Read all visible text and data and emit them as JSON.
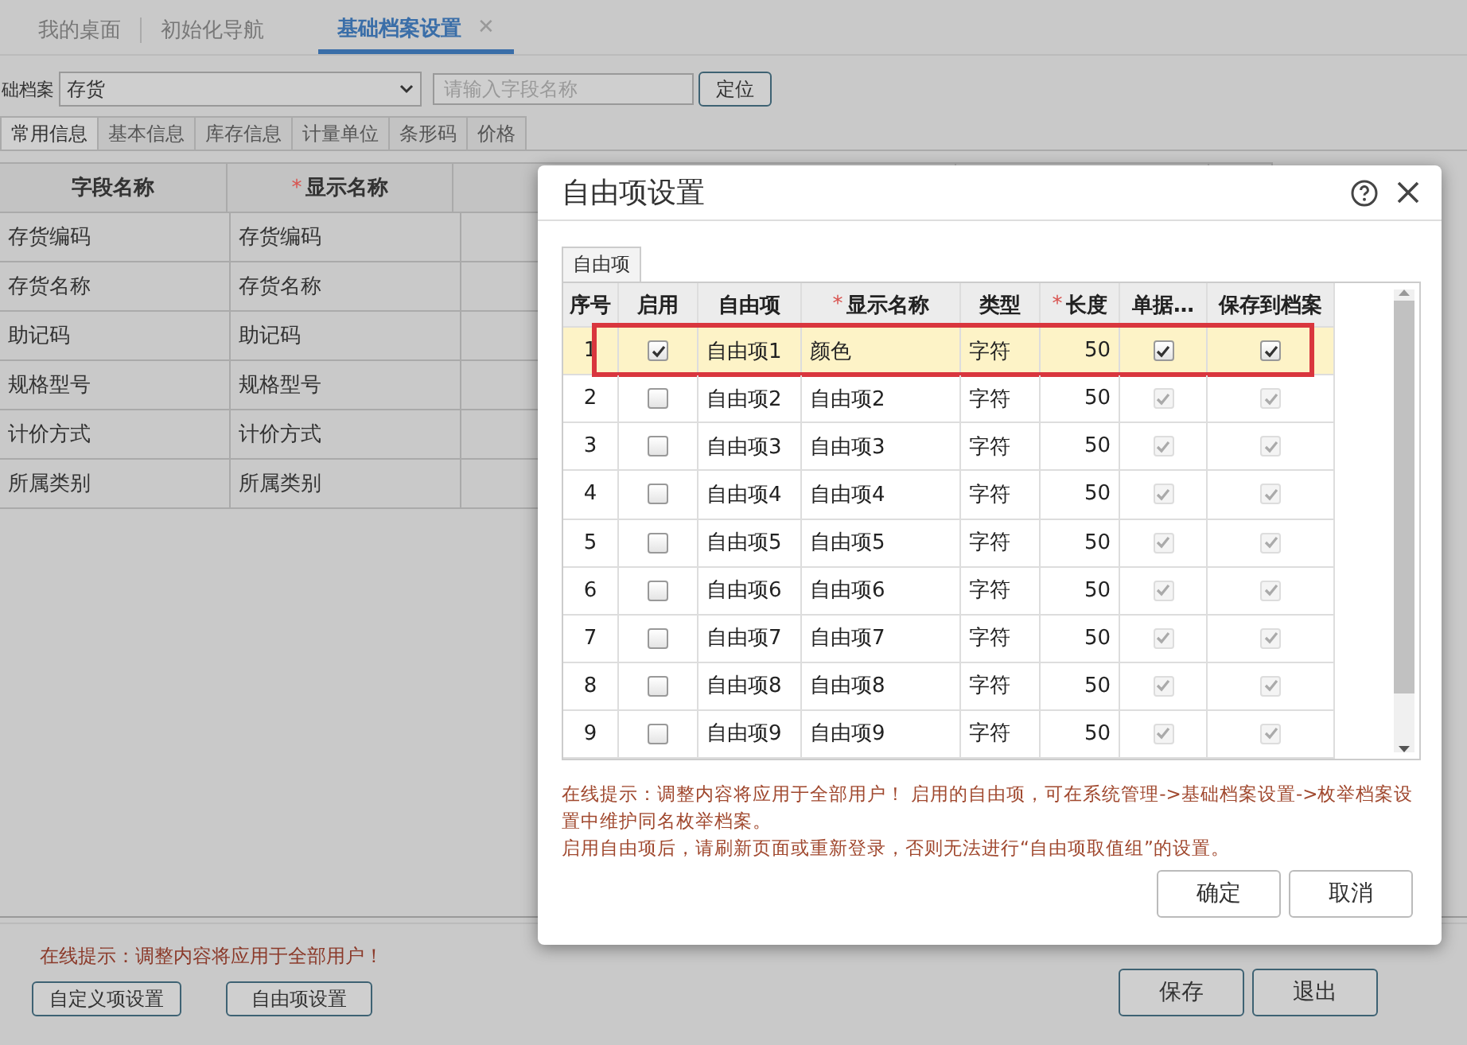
{
  "tabs": [
    {
      "label": "我的桌面",
      "selected": false
    },
    {
      "label": "初始化导航",
      "selected": false
    },
    {
      "label": "基础档案设置",
      "selected": true,
      "close": "✕"
    }
  ],
  "toolbar": {
    "label": "础档案",
    "select_value": "存货",
    "search_placeholder": "请输入字段名称",
    "locate_button": "定位"
  },
  "subtabs": [
    {
      "label": "常用信息",
      "selected": true
    },
    {
      "label": "基本信息",
      "selected": false
    },
    {
      "label": "库存信息",
      "selected": false
    },
    {
      "label": "计量单位",
      "selected": false
    },
    {
      "label": "条形码",
      "selected": false
    },
    {
      "label": "价格",
      "selected": false
    }
  ],
  "table": {
    "columns": [
      {
        "label": "字段名称"
      },
      {
        "label": "显示名称",
        "mark": "*"
      }
    ],
    "rows": [
      [
        "存货编码",
        "存货编码"
      ],
      [
        "存货名称",
        "存货名称"
      ],
      [
        "助记码",
        "助记码"
      ],
      [
        "规格型号",
        "规格型号"
      ],
      [
        "计价方式",
        "计价方式"
      ],
      [
        "所属类别",
        "所属类别"
      ]
    ]
  },
  "footer": {
    "hint": "在线提示：调整内容将应用于全部用户！",
    "buttons": [
      "自定义项设置",
      "自由项设置"
    ],
    "right_buttons": [
      "保存",
      "退出"
    ]
  },
  "dialog": {
    "title": "自由项设置",
    "tab": "自由项",
    "columns": [
      {
        "label": "序号"
      },
      {
        "label": "启用"
      },
      {
        "label": "自由项"
      },
      {
        "label": "显示名称",
        "mark": "*"
      },
      {
        "label": "类型"
      },
      {
        "label": "长度",
        "mark": "*"
      },
      {
        "label": "单据…"
      },
      {
        "label": "保存到档案"
      }
    ],
    "rows": [
      {
        "no": "1",
        "enabled": true,
        "item": "自由项1",
        "display": "颜色",
        "type": "字符",
        "length": "50",
        "bill": true,
        "save": true,
        "selected": true
      },
      {
        "no": "2",
        "enabled": false,
        "item": "自由项2",
        "display": "自由项2",
        "type": "字符",
        "length": "50",
        "bill": true,
        "save": true,
        "selected": false
      },
      {
        "no": "3",
        "enabled": false,
        "item": "自由项3",
        "display": "自由项3",
        "type": "字符",
        "length": "50",
        "bill": true,
        "save": true,
        "selected": false
      },
      {
        "no": "4",
        "enabled": false,
        "item": "自由项4",
        "display": "自由项4",
        "type": "字符",
        "length": "50",
        "bill": true,
        "save": true,
        "selected": false
      },
      {
        "no": "5",
        "enabled": false,
        "item": "自由项5",
        "display": "自由项5",
        "type": "字符",
        "length": "50",
        "bill": true,
        "save": true,
        "selected": false
      },
      {
        "no": "6",
        "enabled": false,
        "item": "自由项6",
        "display": "自由项6",
        "type": "字符",
        "length": "50",
        "bill": true,
        "save": true,
        "selected": false
      },
      {
        "no": "7",
        "enabled": false,
        "item": "自由项7",
        "display": "自由项7",
        "type": "字符",
        "length": "50",
        "bill": true,
        "save": true,
        "selected": false
      },
      {
        "no": "8",
        "enabled": false,
        "item": "自由项8",
        "display": "自由项8",
        "type": "字符",
        "length": "50",
        "bill": true,
        "save": true,
        "selected": false
      },
      {
        "no": "9",
        "enabled": false,
        "item": "自由项9",
        "display": "自由项9",
        "type": "字符",
        "length": "50",
        "bill": true,
        "save": true,
        "selected": false
      }
    ],
    "hints": [
      "在线提示：调整内容将应用于全部用户！ 启用的自由项，可在系统管理->基础档案设置->枚举档案设置中维护同名枚举档案。",
      "启用自由项后，请刷新页面或重新登录，否则无法进行“自由项取值组”的设置。"
    ],
    "buttons": [
      "确定",
      "取消"
    ]
  }
}
